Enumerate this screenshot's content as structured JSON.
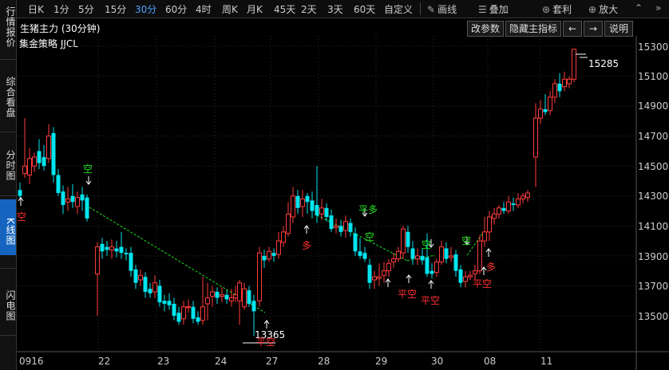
{
  "sidebar": {
    "items": [
      {
        "label": "行情报价",
        "active": false
      },
      {
        "label": "综合看盘",
        "active": false
      },
      {
        "label": "分时图",
        "active": false
      },
      {
        "label": "K线图",
        "active": true
      },
      {
        "label": "闪电图",
        "active": false
      }
    ]
  },
  "toolbar": {
    "periods": [
      "日K",
      "1分",
      "5分",
      "15分",
      "30分",
      "60分",
      "4时",
      "周K",
      "月K",
      "45天",
      "2天",
      "3天",
      "60天",
      "自定义"
    ],
    "active_period": "30分",
    "draw_line": "画线",
    "overlay": "叠加",
    "arbitrage": "套利",
    "zoom_in": "放大"
  },
  "chart": {
    "title": "生猪主力 (30分钟)",
    "strategy": "集金策略 JJCL",
    "buttons": {
      "change_params": "改参数",
      "hide_indicator": "隐藏主指标",
      "left_arrow": "←",
      "right_arrow": "→",
      "help": "说明"
    }
  },
  "chart_data": {
    "type": "candlestick",
    "y_ticks": [
      "15300",
      "15100",
      "14900",
      "14700",
      "14500",
      "14300",
      "14100",
      "13900",
      "13700",
      "13500"
    ],
    "ylim": [
      13300,
      15400
    ],
    "x_ticks": [
      "0916",
      "22",
      "23",
      "24",
      "27",
      "28",
      "29",
      "30",
      "08",
      "11"
    ],
    "annotations": {
      "high_value": "15285",
      "low_value": "13365",
      "signals": [
        {
          "text": "空",
          "color": "#ff3030"
        },
        {
          "text": "空",
          "color": "#20e020"
        },
        {
          "text": "多",
          "color": "#ff3030"
        },
        {
          "text": "平多",
          "color": "#20e020"
        },
        {
          "text": "空",
          "color": "#20e020"
        },
        {
          "text": "平空",
          "color": "#ff3030"
        },
        {
          "text": "空",
          "color": "#20e020"
        },
        {
          "text": "平空",
          "color": "#ff3030"
        },
        {
          "text": "空",
          "color": "#20e020"
        },
        {
          "text": "多",
          "color": "#ff3030"
        },
        {
          "text": "平空",
          "color": "#ff3030"
        },
        {
          "text": "平空",
          "color": "#ff3030"
        }
      ]
    },
    "colors": {
      "up": "#ff3b3b",
      "down": "#00e5ee",
      "dash": "#22dd22",
      "grid": "#2a2a2a"
    }
  }
}
